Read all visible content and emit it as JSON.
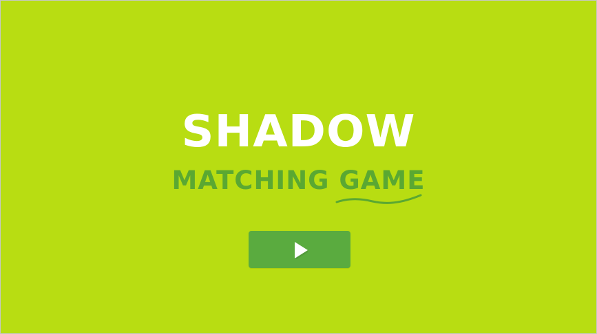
{
  "title": {
    "main": "SHADOW",
    "sub": "MATCHING GAME"
  },
  "play_button": {
    "icon": "play-icon"
  },
  "colors": {
    "background": "#b8dd12",
    "title_main": "#ffffff",
    "title_sub": "#5aa832",
    "button": "#5aab3f",
    "icon": "#ffffff"
  }
}
